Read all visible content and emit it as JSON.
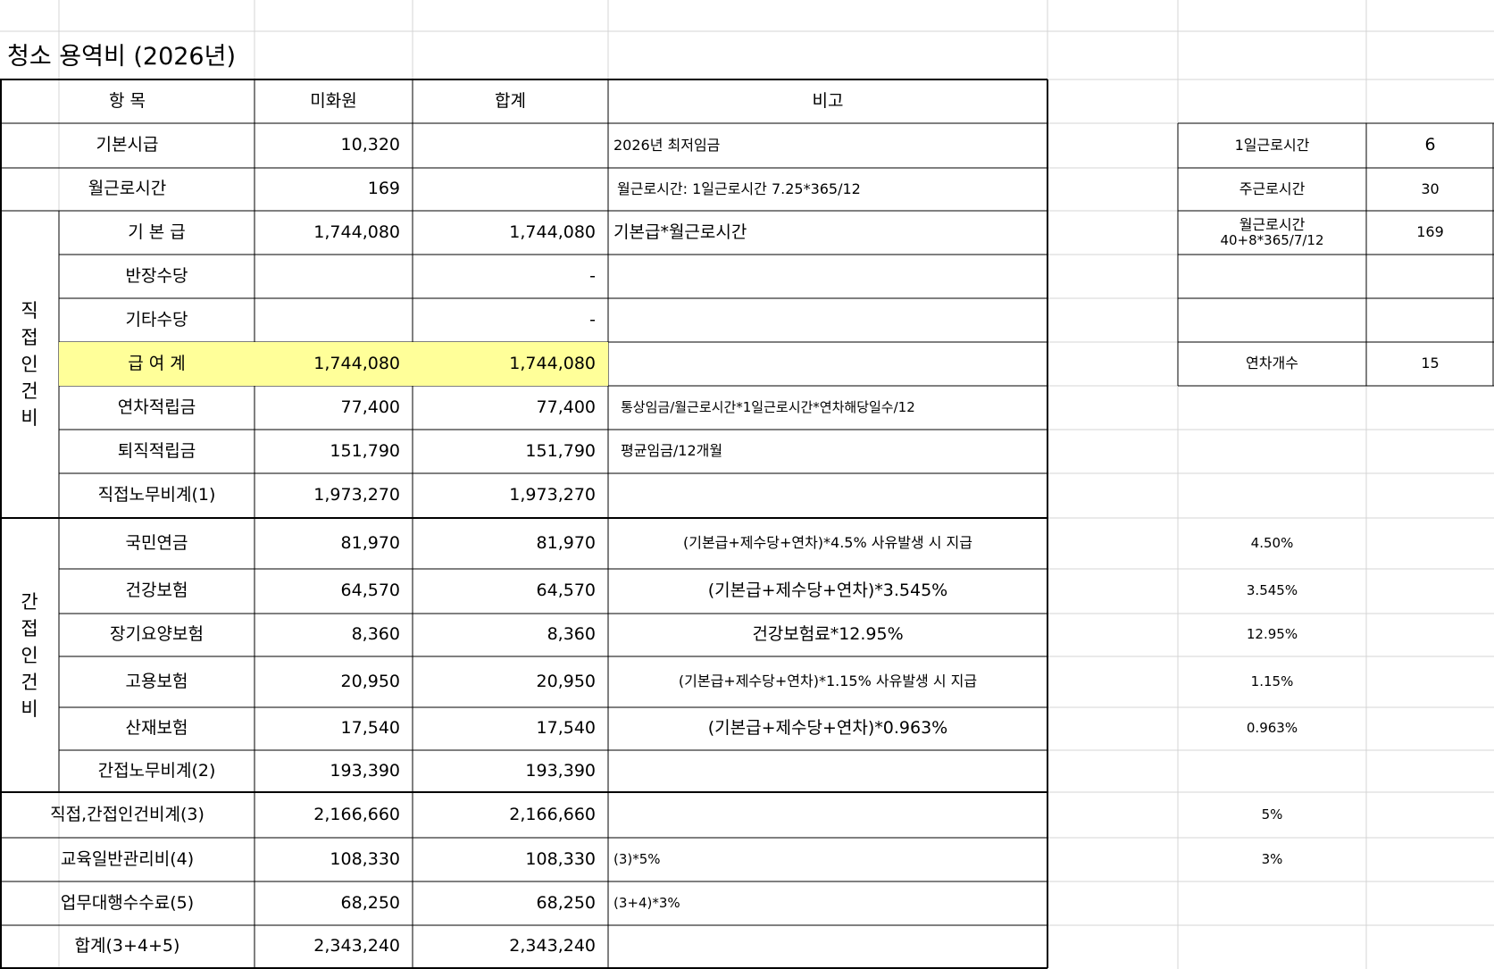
{
  "title": "청소 용역비 (2026년)",
  "headers": {
    "item": "항    목",
    "amount": "미화원",
    "total": "합계",
    "note": "비고"
  },
  "rows": {
    "hourly_wage": {
      "label": "기본시급",
      "amount": "10,320",
      "total": "",
      "note": "2026년 최저임금"
    },
    "monthly_hours": {
      "label": "월근로시간",
      "amount": "169",
      "total": "",
      "note": "월근로시간: 1일근로시간 7.25*365/12"
    },
    "direct_group_label": "직\n접\n인\n건\n비",
    "base_pay": {
      "label": "기 본 급",
      "amount": "1,744,080",
      "total": "1,744,080",
      "note": "기본급*월근로시간"
    },
    "leader_allowance": {
      "label": "반장수당",
      "amount": "",
      "total": "-",
      "note": ""
    },
    "other_allowance": {
      "label": "기타수당",
      "amount": "",
      "total": "-",
      "note": ""
    },
    "salary_total": {
      "label": "급 여 계",
      "amount": "1,744,080",
      "total": "1,744,080",
      "note": ""
    },
    "annual_leave": {
      "label": "연차적립금",
      "amount": "77,400",
      "total": "77,400",
      "note": "통상임금/월근로시간*1일근로시간*연차해당일수/12"
    },
    "severance": {
      "label": "퇴직적립금",
      "amount": "151,790",
      "total": "151,790",
      "note": "평균임금/12개월"
    },
    "direct_total": {
      "label": "직접노무비계(1)",
      "amount": "1,973,270",
      "total": "1,973,270",
      "note": ""
    },
    "indirect_group_label": "간\n접\n인\n건\n비",
    "pension": {
      "label": "국민연금",
      "amount": "81,970",
      "total": "81,970",
      "note": "(기본급+제수당+연차)*4.5%  사유발생 시 지급",
      "rate": "4.50%"
    },
    "health": {
      "label": "건강보험",
      "amount": "64,570",
      "total": "64,570",
      "note": "(기본급+제수당+연차)*3.545%",
      "rate": "3.545%"
    },
    "longterm_care": {
      "label": "장기요양보험",
      "amount": "8,360",
      "total": "8,360",
      "note": "건강보험료*12.95%",
      "rate": "12.95%"
    },
    "employment": {
      "label": "고용보험",
      "amount": "20,950",
      "total": "20,950",
      "note": "(기본급+제수당+연차)*1.15%  사유발생 시 지급",
      "rate": "1.15%"
    },
    "industrial": {
      "label": "산재보험",
      "amount": "17,540",
      "total": "17,540",
      "note": "(기본급+제수당+연차)*0.963%",
      "rate": "0.963%"
    },
    "indirect_total": {
      "label": "간접노무비계(2)",
      "amount": "193,390",
      "total": "193,390",
      "note": ""
    },
    "labor_total": {
      "label": "직접,간접인건비계(3)",
      "amount": "2,166,660",
      "total": "2,166,660",
      "note": "",
      "rate": "5%"
    },
    "admin": {
      "label": "교육일반관리비(4)",
      "amount": "108,330",
      "total": "108,330",
      "note": "(3)*5%",
      "rate": "3%"
    },
    "agency_fee": {
      "label": "업무대행수수료(5)",
      "amount": "68,250",
      "total": "68,250",
      "note": "(3+4)*3%"
    },
    "grand_total": {
      "label": "합계(3+4+5)",
      "amount": "2,343,240",
      "total": "2,343,240",
      "note": ""
    }
  },
  "side_table": {
    "daily_hours": {
      "label": "1일근로시간",
      "value": "6"
    },
    "weekly_hours": {
      "label": "주근로시간",
      "value": "30"
    },
    "monthly_hours": {
      "label": "월근로시간",
      "sub": "40+8*365/7/12",
      "value": "169"
    },
    "leave_count": {
      "label": "연차개수",
      "value": "15"
    }
  }
}
